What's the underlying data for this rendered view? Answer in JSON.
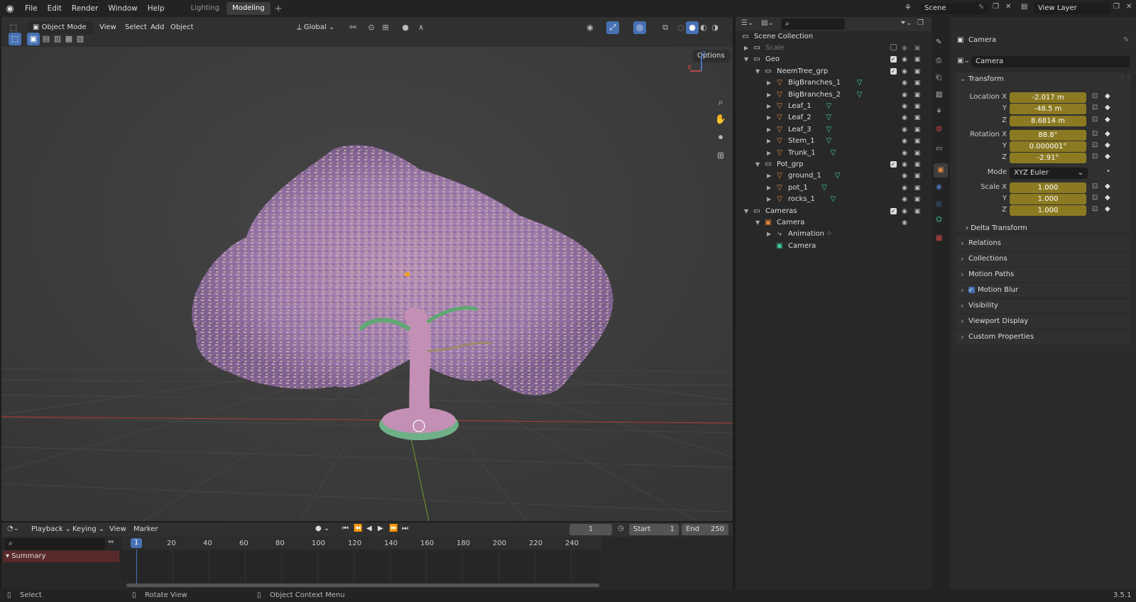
{
  "topbar": {
    "menus": [
      "File",
      "Edit",
      "Render",
      "Window",
      "Help"
    ],
    "workspace_tabs": [
      "Lighting",
      "Modeling"
    ],
    "active_tab": "Modeling",
    "scene": "Scene",
    "view_layer": "View Layer"
  },
  "viewport": {
    "mode": "Object Mode",
    "menus": [
      "View",
      "Select",
      "Add",
      "Object"
    ],
    "transform_orientation": "Global",
    "options_label": "Options",
    "gizmo_x": "X",
    "gizmo_z": "Z"
  },
  "outliner": {
    "root": "Scene Collection",
    "rows": [
      {
        "label": "Scale",
        "depth": 0,
        "type": "collection",
        "muted": true,
        "has_check": true,
        "checked": false
      },
      {
        "label": "Geo",
        "depth": 0,
        "type": "collection",
        "expanded": true,
        "has_check": true,
        "checked": true
      },
      {
        "label": "NeemTree_grp",
        "depth": 1,
        "type": "collection",
        "expanded": true,
        "has_check": true,
        "checked": true
      },
      {
        "label": "BigBranches_1",
        "depth": 2,
        "type": "mesh"
      },
      {
        "label": "BigBranches_2",
        "depth": 2,
        "type": "mesh"
      },
      {
        "label": "Leaf_1",
        "depth": 2,
        "type": "mesh"
      },
      {
        "label": "Leaf_2",
        "depth": 2,
        "type": "mesh"
      },
      {
        "label": "Leaf_3",
        "depth": 2,
        "type": "mesh"
      },
      {
        "label": "Stem_1",
        "depth": 2,
        "type": "mesh"
      },
      {
        "label": "Trunk_1",
        "depth": 2,
        "type": "mesh"
      },
      {
        "label": "Pot_grp",
        "depth": 1,
        "type": "collection",
        "expanded": true,
        "has_check": true,
        "checked": true
      },
      {
        "label": "ground_1",
        "depth": 2,
        "type": "mesh"
      },
      {
        "label": "pot_1",
        "depth": 2,
        "type": "mesh"
      },
      {
        "label": "rocks_1",
        "depth": 2,
        "type": "mesh"
      },
      {
        "label": "Cameras",
        "depth": 0,
        "type": "collection",
        "expanded": true,
        "has_check": true,
        "checked": true
      },
      {
        "label": "Camera",
        "depth": 1,
        "type": "camera",
        "expanded": true
      },
      {
        "label": "Animation",
        "depth": 2,
        "type": "anim"
      },
      {
        "label": "Camera",
        "depth": 2,
        "type": "camdata"
      }
    ]
  },
  "properties": {
    "object_name": "Camera",
    "datablock": "Camera",
    "transform_label": "Transform",
    "location_label": "Location X",
    "location": [
      "-2.017 m",
      "-48.5 m",
      "8.6814 m"
    ],
    "rotation_label": "Rotation X",
    "rotation": [
      "88.8°",
      "0.000001°",
      "-2.91°"
    ],
    "mode_label": "Mode",
    "mode_value": "XYZ Euler",
    "scale_label": "Scale X",
    "scale": [
      "1.000",
      "1.000",
      "1.000"
    ],
    "axis_y": "Y",
    "axis_z": "Z",
    "delta_transform": "Delta Transform",
    "panels": [
      "Relations",
      "Collections",
      "Motion Paths",
      "Motion Blur",
      "Visibility",
      "Viewport Display",
      "Custom Properties"
    ]
  },
  "timeline": {
    "menus": [
      "Playback",
      "Keying",
      "View",
      "Marker"
    ],
    "current_frame": "1",
    "start_label": "Start",
    "start": "1",
    "end_label": "End",
    "end": "250",
    "ticks": [
      "20",
      "40",
      "60",
      "80",
      "100",
      "120",
      "140",
      "160",
      "180",
      "200",
      "220",
      "240"
    ],
    "playhead": "1",
    "summary": "Summary"
  },
  "statusbar": {
    "select": "Select",
    "rotate": "Rotate View",
    "context": "Object Context Menu",
    "version": "3.5.1"
  },
  "colors": {
    "accent": "#4772b3",
    "field_yellow": "#8c7a22",
    "mesh_orange": "#e5883c",
    "data_green": "#3fd3a0",
    "leaf_purple": "#a784b8"
  }
}
